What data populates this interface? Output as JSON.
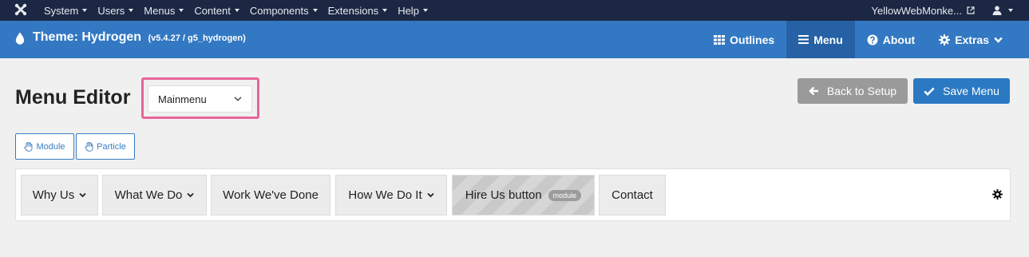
{
  "topbar": {
    "menu": [
      {
        "label": "System"
      },
      {
        "label": "Users"
      },
      {
        "label": "Menus"
      },
      {
        "label": "Content"
      },
      {
        "label": "Components"
      },
      {
        "label": "Extensions"
      },
      {
        "label": "Help"
      }
    ],
    "site_link": "YellowWebMonke...",
    "icons": {
      "logo": "joomla-logo-icon",
      "external": "external-link-icon",
      "user": "user-icon"
    }
  },
  "header": {
    "title": "Theme: Hydrogen",
    "version": "(v5.4.27 / g5_hydrogen)",
    "nav": [
      {
        "label": "Outlines",
        "icon": "grid-icon",
        "active": false
      },
      {
        "label": "Menu",
        "icon": "bars-icon",
        "active": true
      },
      {
        "label": "About",
        "icon": "question-circle-icon",
        "active": false
      },
      {
        "label": "Extras",
        "icon": "gear-icon",
        "active": false
      }
    ]
  },
  "editor": {
    "title": "Menu Editor",
    "selected_menu": "Mainmenu",
    "back_label": "Back to Setup",
    "save_label": "Save Menu",
    "module_label": "Module",
    "particle_label": "Particle"
  },
  "menubar": {
    "items": [
      {
        "label": "Why Us",
        "has_children": true
      },
      {
        "label": "What We Do",
        "has_children": true
      },
      {
        "label": "Work We've Done",
        "has_children": false
      },
      {
        "label": "How We Do It",
        "has_children": true
      },
      {
        "label": "Hire Us button",
        "badge": "module",
        "has_children": false
      },
      {
        "label": "Contact",
        "has_children": false
      }
    ]
  },
  "colors": {
    "topbar": "#1b2743",
    "header": "#3378c2",
    "header_active": "#2561a4",
    "save_button": "#2b79c3",
    "back_button": "#9a9a9a",
    "highlight": "#e8659a"
  }
}
